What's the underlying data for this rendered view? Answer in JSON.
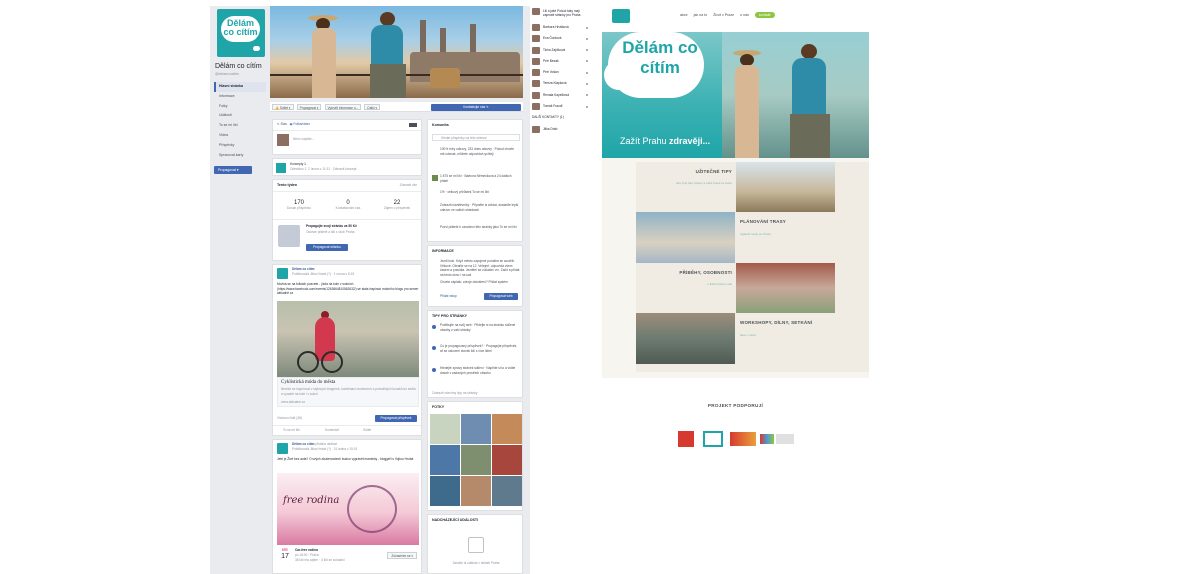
{
  "facebook": {
    "page_name": "Dělám co cítím",
    "page_handle": "@delamcocitim",
    "logo_text": "Dělám co cítím",
    "nav": [
      "Hlavní stránka",
      "Informace",
      "Fotky",
      "Události",
      "To se mi líbí",
      "Videa",
      "Příspěvky",
      "Spravovat karty"
    ],
    "promote_label": "Propagovat ▾",
    "actions": [
      "👍 Sdílet ▾",
      "Propagovat ▾",
      "Vytvořit informace o...",
      "Další ▾"
    ],
    "primary_action": "Kontaktujte nás ✎",
    "composer": {
      "tabs": [
        "✎ Stav",
        "▣ Fotka/video"
      ],
      "placeholder": "Něco napište..."
    },
    "event_card": {
      "title": "Koncepty 1",
      "meta": "Odesláno 1. 2 února v 11:31 · Zobrazit koncept"
    },
    "week": {
      "title": "Tento týden",
      "more": "Zobrazit vše",
      "stats": [
        {
          "value": "170",
          "label": "Dosah příspěvku"
        },
        {
          "value": "0",
          "label": "Kontaktování nás"
        },
        {
          "value": "22",
          "label": "Zájem o příspěvek"
        }
      ],
      "promo_title": "Propagujte svoji stránku za 50 Kč",
      "promo_text": "Oslovte přátelé a lidi z okolí Praha",
      "promo_button": "Propagovat stránku"
    },
    "post1": {
      "author": "Dělám co cítím",
      "meta": "Publikoval/a Jitka Hrubá (?) · 1 února v 8:15",
      "text": "Možná se na folkách pozvete - jízda na kole v sukních (https://www.facebook.com/events/1263664810562632/) se stala inspirací módního blogu pro server aktuálně.cz",
      "link_title": "Cyklistická móda do města",
      "link_text": "Nechte se inspirovat v stylových blogerek, kombinací moderních a pohodlných kousků do sedla a vyrazte na kole i v sukni.",
      "link_source": "zena.aktualne.cz",
      "footer_left": "Oslovení lidé (38)",
      "footer_button": "Propagovat příspěvek",
      "reactions": [
        "To se mi líbí",
        "Komentář",
        "Sdílet"
      ]
    },
    "post2": {
      "author": "Dělám co cítím",
      "author_suffix": "přidal/a událost",
      "meta": "Publikoval/a Jitka Hrubá (?) · 31 ledna v 15:01",
      "text": "Jeté je Živé bez auta? O svých zkušenostech budou vyprávět maminky - bloggeři s Vojtou Hrubá",
      "poster_title": "free rodina",
      "event_month": "BŘE",
      "event_day": "17",
      "event_title": "Car-free rodina",
      "event_meta": "po 18:00 · Praha",
      "event_interest": "38 lidí má zájem · 4 lidí se zúčastní",
      "event_button": "Zúčastním se ▾"
    },
    "community": {
      "title": "Komunita",
      "search_placeholder": "Hledat příspěvky na této stránce",
      "rows": [
        "100% míry odezvy, 233 dnes odezvy · Pokud chcete mít odznak, můžete odpovídat rychleji",
        "1 875 se mi líbí · Barbora Němečková a 24 dalších přátel",
        "1% · celkový přírůstek To se mi líbí",
        "Zobrazit návštěvníky · Připněte si zbídat, dostaňte lepší odezvu ve vašich stránkách"
      ],
      "extra": "Pozvi přátele k označení této stránky jako To se mi líbí"
    },
    "info": {
      "title": "INFORMACE",
      "text": "Jezdi kolo. Když město zapojené pomáhá se soutěží. Věkové: Obraťte se na 12. Veřejné, odpovídá všem časem a pravidla. Jezdění se zúčastní víc. Začít a přidat na tento okno i na svá",
      "cta": "Chcete záplatu: zdroje dotváření? Přidat systém",
      "cta_left": "Přidat vstup",
      "cta_button": "Propagovat web"
    },
    "tips": {
      "title": "TIPY PRO STRÁNKY",
      "items": [
        "Publikujte na svůj web · Přidejte si na stránku sdílené obsahy z vaší stránky",
        "Co je propagovaný příspěvek? · Propagujte příspěvek, ať se oslovení stovek lidí s více lidmi",
        "Hledejte zprávy stránek sdílení · Naplňte si to a vidíte dosah v zadaných prostředí obsahu"
      ],
      "footer": "Zobrazit všechny tipy na stránky"
    },
    "photos": {
      "title": "FOTKY"
    },
    "upcoming": {
      "title": "NADCHÁZEJÍCÍ UDÁLOSTI",
      "text": "Založte si událost v oblasti Praha"
    },
    "friends": {
      "top_name": "Lili a jaké Pokud taky mají zapnuté stránky pro Praha",
      "names": [
        "Barbora Hrušková",
        "Eva Čurdová",
        "Ticha Zajíčková",
        "Petr Bezák",
        "Petr Vošan",
        "Tereza Klapková",
        "Renata Kapelková",
        "Tomáš Fraudl"
      ],
      "section_label": "DALŠÍ KONTAKTY (1)",
      "last": "Jitka Dráb"
    }
  },
  "website": {
    "logo_text": "Dělám co cítím",
    "nav": [
      "akce",
      "jak na to",
      "Život v Praze",
      "o nás"
    ],
    "nav_pill": "kontakt",
    "hero_tagline_prefix": "Zažít Prahu",
    "hero_tagline_bold": "zdravěji...",
    "sections": [
      {
        "title": "UŽITEČNÉ TIPY",
        "sub": "aby bylo fajn zdravý a začít hned na cestu"
      },
      {
        "title": "PLÁNOVÁNÍ TRASY",
        "sub": "nejlepší cesty po Praze"
      },
      {
        "title": "PŘÍBĚHY, OSOBNOSTI",
        "sub": "o lidech kolem vás"
      },
      {
        "title": "WORKSHOPY, DÍLNY, SETKÁNÍ",
        "sub": "akce v okolí"
      }
    ],
    "support_title": "PROJEKT PODPORUJÍ",
    "sponsors": [
      "sponsor-red",
      "sponsor-teal",
      "sponsor-svetla",
      "sponsor-mesto"
    ]
  }
}
